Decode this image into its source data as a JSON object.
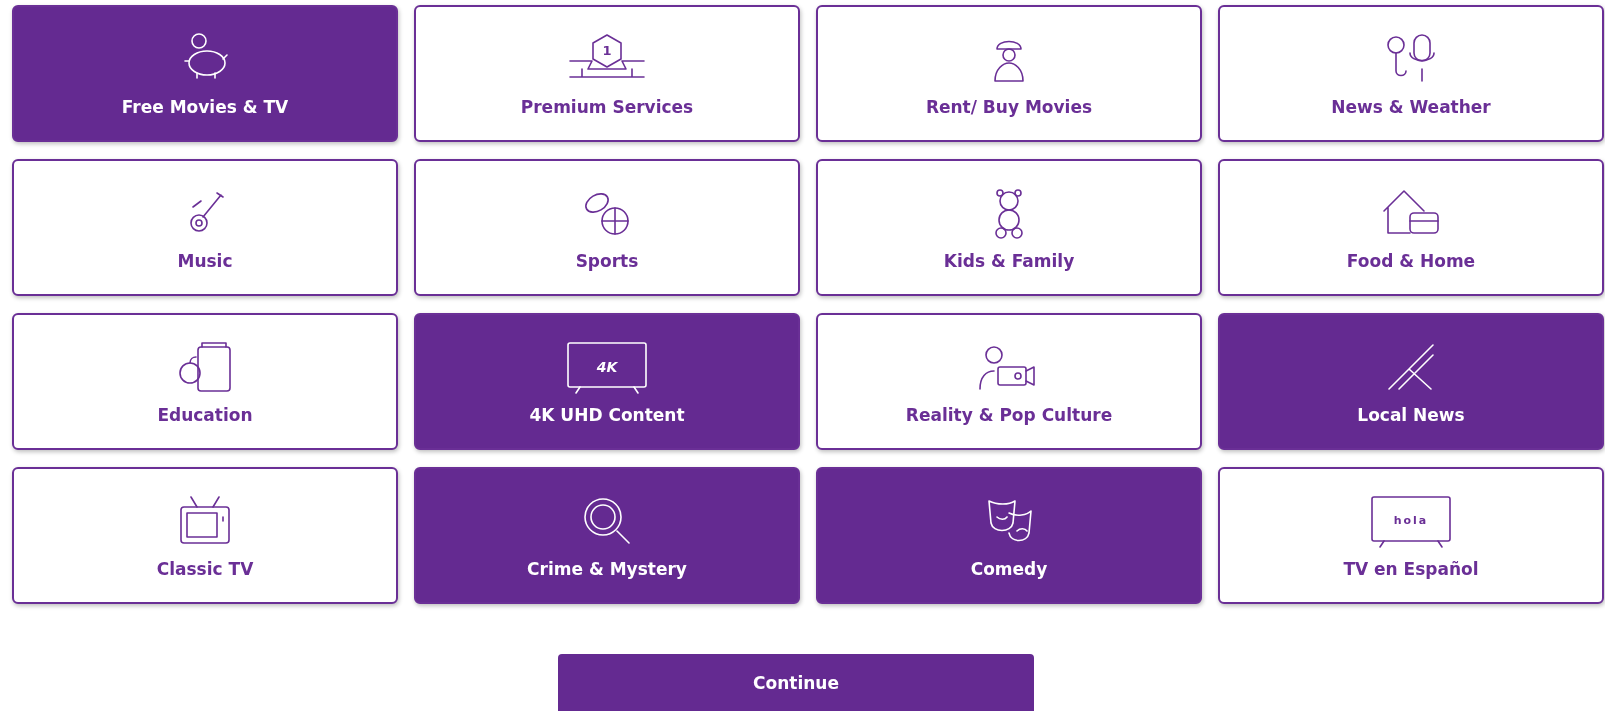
{
  "categories": [
    {
      "label": "Free Movies & TV",
      "selected": true
    },
    {
      "label": "Premium Services",
      "selected": false,
      "icon_text": "1"
    },
    {
      "label": "Rent/ Buy Movies",
      "selected": false
    },
    {
      "label": "News & Weather",
      "selected": false
    },
    {
      "label": "Music",
      "selected": false
    },
    {
      "label": "Sports",
      "selected": false
    },
    {
      "label": "Kids & Family",
      "selected": false
    },
    {
      "label": "Food & Home",
      "selected": false
    },
    {
      "label": "Education",
      "selected": false
    },
    {
      "label": "4K UHD Content",
      "selected": true,
      "icon_text": "4K"
    },
    {
      "label": "Reality & Pop Culture",
      "selected": false
    },
    {
      "label": "Local News",
      "selected": true
    },
    {
      "label": "Classic TV",
      "selected": false
    },
    {
      "label": "Crime & Mystery",
      "selected": true
    },
    {
      "label": "Comedy",
      "selected": true
    },
    {
      "label": "TV en Español",
      "selected": false,
      "icon_text": "hola"
    }
  ],
  "continue_button": "Continue"
}
